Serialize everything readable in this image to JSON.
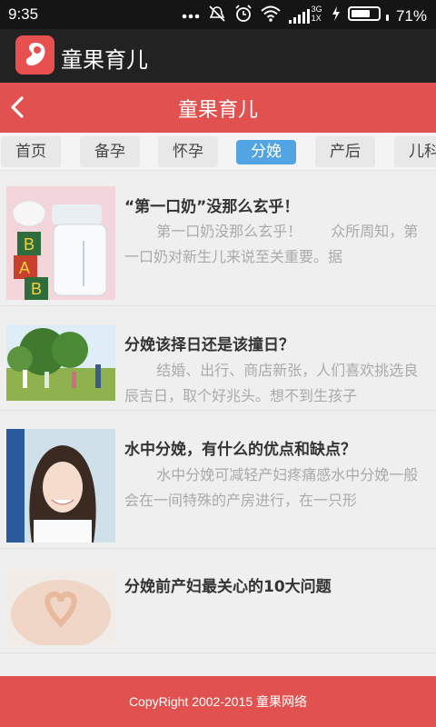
{
  "status": {
    "time": "9:35",
    "battery": "71%",
    "battery_level": 0.71,
    "network_label_top": "3G",
    "network_label_bottom": "1X"
  },
  "app_bar": {
    "title": "童果育儿"
  },
  "header": {
    "title": "童果育儿"
  },
  "tabs": [
    {
      "label": "首页"
    },
    {
      "label": "备孕"
    },
    {
      "label": "怀孕"
    },
    {
      "label": "分娩",
      "active": true
    },
    {
      "label": "产后"
    },
    {
      "label": "儿科"
    }
  ],
  "articles": [
    {
      "title": "“第一口奶”没那么玄乎！",
      "summary": "第一口奶没那么玄乎！　　众所周知，第一口奶对新生儿来说至关重要。据"
    },
    {
      "title": "分娩该择日还是该撞日？",
      "summary": "结婚、出行、商店新张，人们喜欢挑选良辰吉日，取个好兆头。想不到生孩子"
    },
    {
      "title": "水中分娩，有什么的优点和缺点？",
      "summary": "水中分娩可减轻产妇疼痛感水中分娩一般会在一间特殊的产房进行，在一只形"
    },
    {
      "title": "分娩前产妇最关心的10大问题",
      "summary": ""
    }
  ],
  "footer": {
    "text": "CopyRight 2002-2015 童果网络"
  },
  "colors": {
    "brand_red": "#e0514f",
    "tab_active": "#52a4e2"
  }
}
